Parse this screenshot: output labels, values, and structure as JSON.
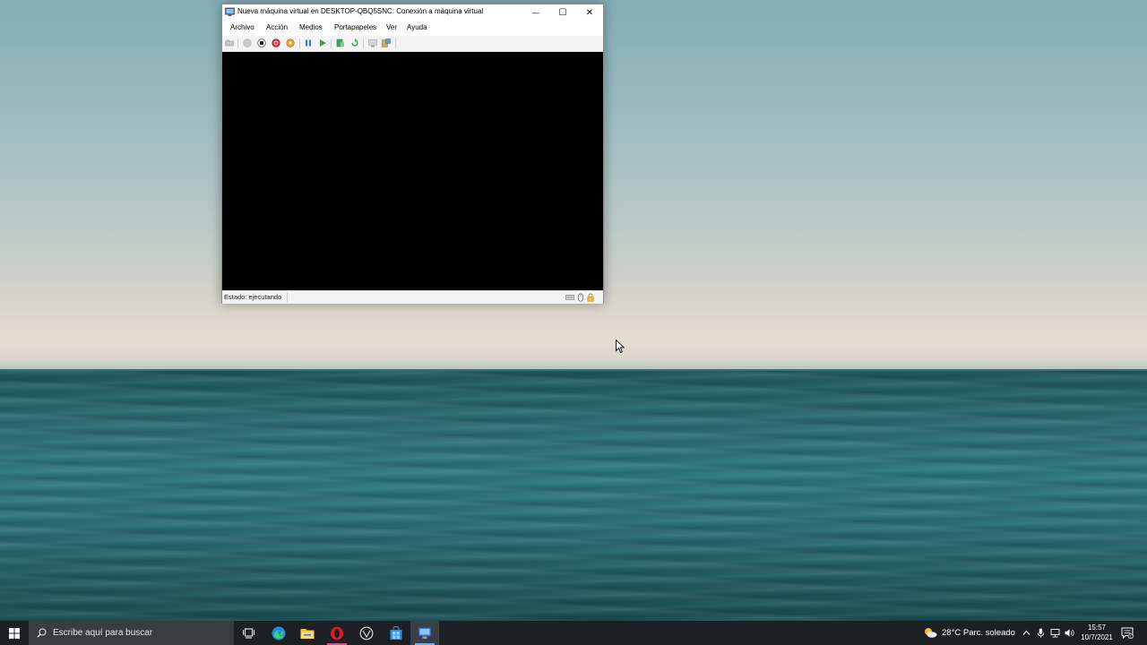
{
  "window": {
    "title": "Nueva máquina virtual en DESKTOP-QBQ5SNC: Conexión a máquina virtual",
    "minimize_glyph": "—",
    "maximize_glyph": "☐",
    "close_glyph": "✕",
    "menu": {
      "archivo": "Archivo",
      "accion": "Acción",
      "medios": "Medios",
      "portapapeles": "Portapapeles",
      "ver": "Ver",
      "ayuda": "Ayuda"
    },
    "toolbar_icons": [
      "ctrl-alt-del-icon",
      "start-icon",
      "turn-off-icon",
      "shutdown-icon",
      "save-icon",
      "pause-icon",
      "resume-icon",
      "checkpoint-icon",
      "revert-icon",
      "enhanced-session-icon",
      "share-icon"
    ],
    "status": "Estado: ejecutando",
    "status_icons": [
      "keyboard-icon",
      "mouse-icon",
      "lock-icon"
    ],
    "screen_color": "#000000"
  },
  "taskbar": {
    "search_placeholder": "Escribe aquí para buscar",
    "apps": [
      "task-view-icon",
      "edge-icon",
      "file-explorer-icon",
      "opera-icon",
      "vmware-icon",
      "store-icon",
      "hyper-v-icon"
    ],
    "weather": "28°C  Parc. soleado",
    "tray_icons": [
      "chevron-up-icon",
      "microphone-icon",
      "network-icon",
      "volume-icon"
    ],
    "time": "15:57",
    "date": "10/7/2021",
    "notification_count": "1"
  },
  "colors": {
    "taskbar_bg": "#1d1f22",
    "accent_underline": "#7aa8e0",
    "sea": "#2b7079",
    "sky": "#a9c2c3"
  }
}
